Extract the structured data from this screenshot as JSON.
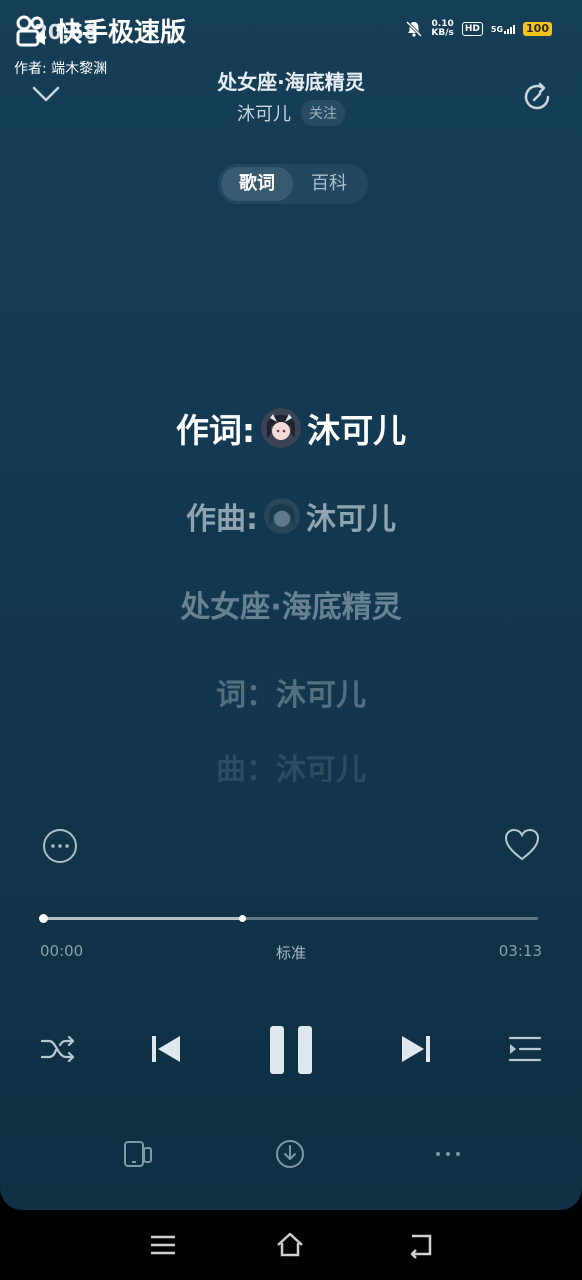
{
  "status_bar": {
    "app_overlay": "快手极速版",
    "time": "20:58",
    "author_line": "作者: 端木黎渊",
    "net_speed_value": "0.10",
    "net_speed_unit": "KB/s",
    "hd": "HD",
    "network": "5G",
    "battery": "100"
  },
  "header": {
    "song_title": "处女座·海底精灵",
    "artist": "沐可儿",
    "follow_label": "关注"
  },
  "tabs": [
    {
      "label": "歌词",
      "active": true
    },
    {
      "label": "百科",
      "active": false
    }
  ],
  "lyrics": {
    "line1_prefix": "作词:",
    "line1_name": "沐可儿",
    "line2_prefix": "作曲:",
    "line2_name": "沐可儿",
    "line3": "处女座·海底精灵",
    "line4": "词：沐可儿",
    "line5": "曲：沐可儿"
  },
  "player": {
    "current_time": "00:00",
    "total_time": "03:13",
    "quality": "标准",
    "progress_fraction": 0.0,
    "buffer_fraction": 0.4
  },
  "colors": {
    "background_top": "#153f57",
    "background_bottom": "#0f2f43",
    "battery": "#f4c21b"
  }
}
